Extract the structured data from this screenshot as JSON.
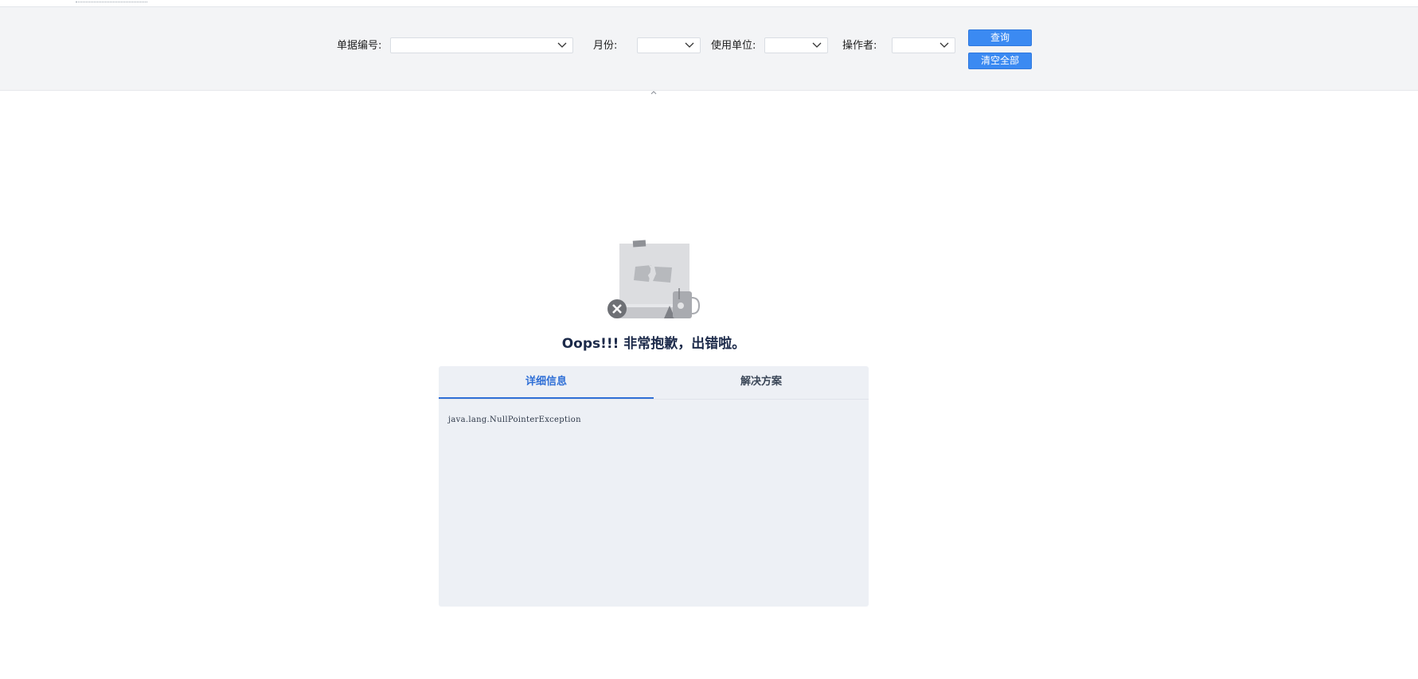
{
  "filters": {
    "doc_no": {
      "label": "单据编号:",
      "value": ""
    },
    "month": {
      "label": "月份:",
      "value": ""
    },
    "unit": {
      "label": "使用单位:",
      "value": ""
    },
    "operator": {
      "label": "操作者:",
      "value": ""
    }
  },
  "buttons": {
    "query": "查询",
    "clear_all": "清空全部"
  },
  "error": {
    "title": "Oops!!! 非常抱歉，出错啦。",
    "tabs": [
      {
        "label": "详细信息",
        "active": true
      },
      {
        "label": "解决方案",
        "active": false
      }
    ],
    "detail": "java.lang.NullPointerException"
  },
  "colors": {
    "accent": "#3b8af2",
    "tab_active": "#2f6fd6",
    "title": "#1c2a4a"
  }
}
